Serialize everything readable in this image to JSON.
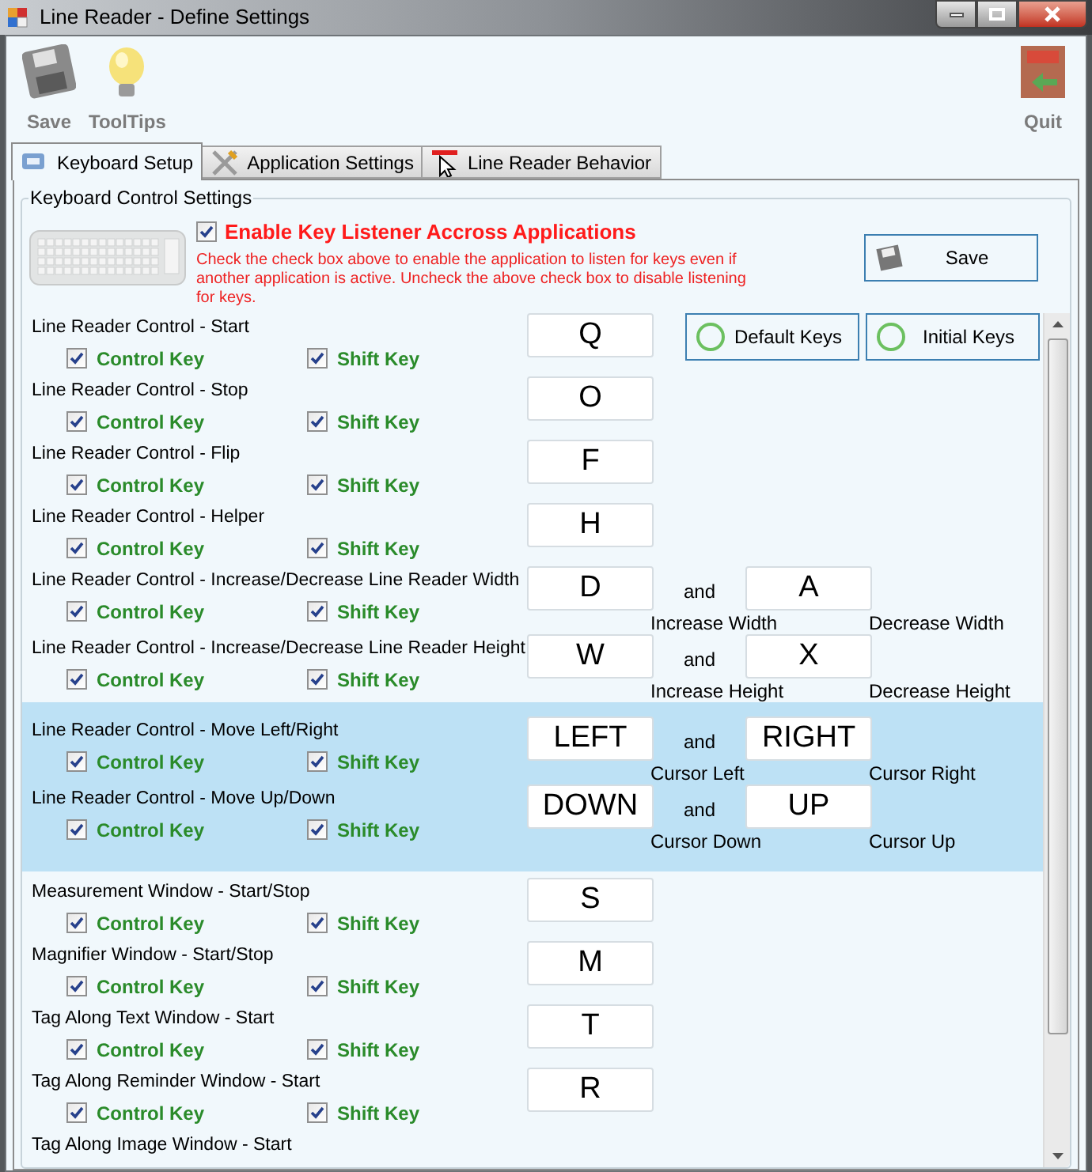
{
  "window": {
    "title": "Line Reader - Define Settings"
  },
  "toolbar": [
    {
      "kind": "save",
      "label": "Save"
    },
    {
      "kind": "tooltips",
      "label": "ToolTips"
    },
    {
      "kind": "quit",
      "label": "Quit"
    }
  ],
  "tabs": [
    {
      "kind": "keyboard",
      "label": "Keyboard Setup",
      "selected": true
    },
    {
      "kind": "tools",
      "label": "Application Settings",
      "selected": false
    },
    {
      "kind": "cursor",
      "label": "Line Reader Behavior",
      "selected": false
    }
  ],
  "group_title": "Keyboard Control Settings",
  "listener": {
    "label": "Enable Key Listener Accross Applications",
    "checked": true,
    "description": "Check the check box above to enable the application to listen for keys even if another application is active. Uncheck the above check box to disable listening for keys."
  },
  "save_button": "Save",
  "default_keys_button": "Default Keys",
  "initial_keys_button": "Initial Keys",
  "rows": [
    {
      "title": "Line Reader Control - Start",
      "highlighted": false,
      "control_key": {
        "label": "Control Key",
        "checked": true
      },
      "shift_key": {
        "label": "Shift Key",
        "checked": true
      },
      "keys": [
        {
          "value": "Q"
        }
      ]
    },
    {
      "title": "Line Reader Control - Stop",
      "highlighted": false,
      "control_key": {
        "label": "Control Key",
        "checked": true
      },
      "shift_key": {
        "label": "Shift Key",
        "checked": true
      },
      "keys": [
        {
          "value": "O"
        }
      ]
    },
    {
      "title": "Line Reader Control - Flip",
      "highlighted": false,
      "control_key": {
        "label": "Control Key",
        "checked": true
      },
      "shift_key": {
        "label": "Shift Key",
        "checked": true
      },
      "keys": [
        {
          "value": "F"
        }
      ]
    },
    {
      "title": "Line Reader Control - Helper",
      "highlighted": false,
      "control_key": {
        "label": "Control Key",
        "checked": true
      },
      "shift_key": {
        "label": "Shift Key",
        "checked": true
      },
      "keys": [
        {
          "value": "H"
        }
      ]
    },
    {
      "title": "Line Reader Control - Increase/Decrease Line Reader Width",
      "highlighted": false,
      "control_key": {
        "label": "Control Key",
        "checked": true
      },
      "shift_key": {
        "label": "Shift Key",
        "checked": true
      },
      "keys": [
        {
          "value": "D",
          "caption": "Increase Width"
        },
        {
          "value": "A",
          "caption": "Decrease Width"
        }
      ],
      "joiner": "and"
    },
    {
      "title": "Line Reader Control - Increase/Decrease Line Reader Height",
      "highlighted": false,
      "control_key": {
        "label": "Control Key",
        "checked": true
      },
      "shift_key": {
        "label": "Shift Key",
        "checked": true
      },
      "keys": [
        {
          "value": "W",
          "caption": "Increase Height"
        },
        {
          "value": "X",
          "caption": "Decrease Height"
        }
      ],
      "joiner": "and"
    },
    {
      "title": "Line Reader Control - Move Left/Right",
      "highlighted": true,
      "control_key": {
        "label": "Control Key",
        "checked": true
      },
      "shift_key": {
        "label": "Shift Key",
        "checked": true
      },
      "keys": [
        {
          "value": "LEFT",
          "caption": "Cursor Left"
        },
        {
          "value": "RIGHT",
          "caption": "Cursor Right"
        }
      ],
      "joiner": "and"
    },
    {
      "title": "Line Reader Control - Move Up/Down",
      "highlighted": true,
      "control_key": {
        "label": "Control Key",
        "checked": true
      },
      "shift_key": {
        "label": "Shift Key",
        "checked": true
      },
      "keys": [
        {
          "value": "DOWN",
          "caption": "Cursor Down"
        },
        {
          "value": "UP",
          "caption": "Cursor Up"
        }
      ],
      "joiner": "and"
    },
    {
      "title": "Measurement Window - Start/Stop",
      "highlighted": false,
      "control_key": {
        "label": "Control Key",
        "checked": true
      },
      "shift_key": {
        "label": "Shift Key",
        "checked": true
      },
      "keys": [
        {
          "value": "S"
        }
      ]
    },
    {
      "title": "Magnifier Window - Start/Stop",
      "highlighted": false,
      "control_key": {
        "label": "Control Key",
        "checked": true
      },
      "shift_key": {
        "label": "Shift Key",
        "checked": true
      },
      "keys": [
        {
          "value": "M"
        }
      ]
    },
    {
      "title": "Tag Along Text Window - Start",
      "highlighted": false,
      "control_key": {
        "label": "Control Key",
        "checked": true
      },
      "shift_key": {
        "label": "Shift Key",
        "checked": true
      },
      "keys": [
        {
          "value": "T"
        }
      ]
    },
    {
      "title": "Tag Along Reminder Window - Start",
      "highlighted": false,
      "control_key": {
        "label": "Control Key",
        "checked": true
      },
      "shift_key": {
        "label": "Shift Key",
        "checked": true
      },
      "keys": [
        {
          "value": "R"
        }
      ]
    },
    {
      "title": "Tag Along Image Window - Start",
      "highlighted": false
    }
  ]
}
